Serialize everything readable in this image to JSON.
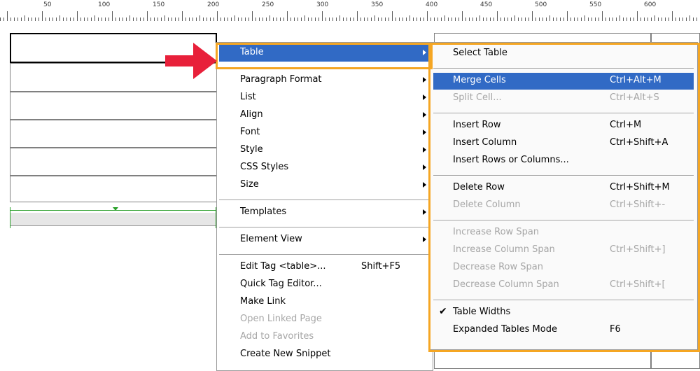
{
  "ruler": {
    "labels": [
      "50",
      "100",
      "150",
      "200",
      "250",
      "300",
      "350",
      "400",
      "450",
      "500",
      "550",
      "600"
    ]
  },
  "menu": {
    "items": [
      {
        "label": "Table",
        "shortcut": "",
        "submenu": true,
        "state": "highlighted"
      },
      {
        "separator": true
      },
      {
        "label": "Paragraph Format",
        "shortcut": "",
        "submenu": true
      },
      {
        "label": "List",
        "shortcut": "",
        "submenu": true
      },
      {
        "label": "Align",
        "shortcut": "",
        "submenu": true
      },
      {
        "label": "Font",
        "shortcut": "",
        "submenu": true
      },
      {
        "label": "Style",
        "shortcut": "",
        "submenu": true
      },
      {
        "label": "CSS Styles",
        "shortcut": "",
        "submenu": true
      },
      {
        "label": "Size",
        "shortcut": "",
        "submenu": true
      },
      {
        "separator": true
      },
      {
        "label": "Templates",
        "shortcut": "",
        "submenu": true
      },
      {
        "separator": true
      },
      {
        "label": "Element View",
        "shortcut": "",
        "submenu": true
      },
      {
        "separator": true
      },
      {
        "label": "Edit Tag <table>...",
        "shortcut": "Shift+F5",
        "submenu": false
      },
      {
        "label": "Quick Tag Editor...",
        "shortcut": "",
        "submenu": false
      },
      {
        "label": "Make Link",
        "shortcut": "",
        "submenu": false
      },
      {
        "label": "Open Linked Page",
        "shortcut": "",
        "submenu": false,
        "state": "disabled"
      },
      {
        "label": "Add to Favorites",
        "shortcut": "",
        "submenu": false,
        "state": "disabled"
      },
      {
        "label": "Create New Snippet",
        "shortcut": "",
        "submenu": false
      }
    ]
  },
  "submenu": {
    "items": [
      {
        "label": "Select Table",
        "shortcut": ""
      },
      {
        "separator": true
      },
      {
        "label": "Merge Cells",
        "shortcut": "Ctrl+Alt+M",
        "state": "highlighted"
      },
      {
        "label": "Split Cell...",
        "shortcut": "Ctrl+Alt+S",
        "state": "disabled"
      },
      {
        "separator": true
      },
      {
        "label": "Insert Row",
        "shortcut": "Ctrl+M"
      },
      {
        "label": "Insert Column",
        "shortcut": "Ctrl+Shift+A"
      },
      {
        "label": "Insert Rows or Columns...",
        "shortcut": ""
      },
      {
        "separator": true
      },
      {
        "label": "Delete Row",
        "shortcut": "Ctrl+Shift+M"
      },
      {
        "label": "Delete Column",
        "shortcut": "Ctrl+Shift+-",
        "state": "disabled"
      },
      {
        "separator": true
      },
      {
        "label": "Increase Row Span",
        "shortcut": "",
        "state": "disabled"
      },
      {
        "label": "Increase Column Span",
        "shortcut": "Ctrl+Shift+]",
        "state": "disabled"
      },
      {
        "label": "Decrease Row Span",
        "shortcut": "",
        "state": "disabled"
      },
      {
        "label": "Decrease Column Span",
        "shortcut": "Ctrl+Shift+[",
        "state": "disabled"
      },
      {
        "separator": true
      },
      {
        "label": "Table Widths",
        "shortcut": "",
        "checked": true
      },
      {
        "label": "Expanded Tables Mode",
        "shortcut": "F6"
      }
    ]
  },
  "colors": {
    "highlight": "#316ac5",
    "annotation_orange": "#f5a623",
    "annotation_red": "#e8203a",
    "guide_green": "#2aa02a"
  },
  "icons": {
    "pointer": "red-arrow-icon",
    "check": "checkmark-icon",
    "submenu": "submenu-arrow-icon"
  }
}
